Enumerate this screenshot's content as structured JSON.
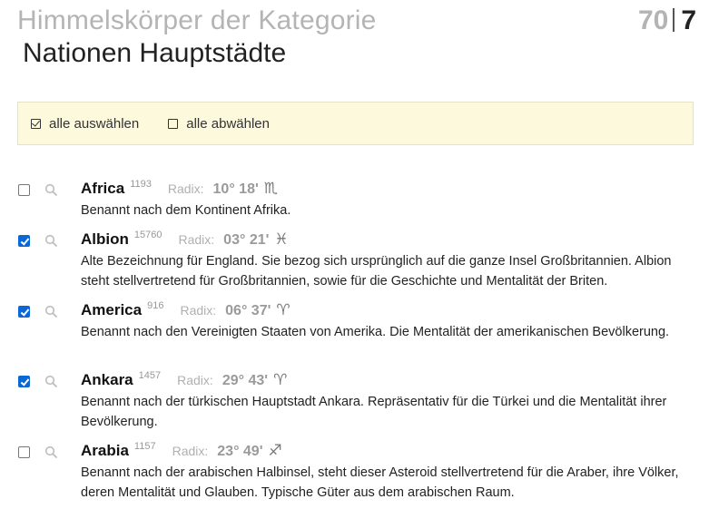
{
  "header": {
    "category_line": "Himmelskörper der Kategorie",
    "title": "Nationen Hauptstädte",
    "count_total": "70",
    "count_selected": "7"
  },
  "selection_bar": {
    "select_all": "alle auswählen",
    "deselect_all": "alle abwählen"
  },
  "radix_label": "Radix:",
  "items": [
    {
      "name": "Africa",
      "number": "1193",
      "position": "10° 18'",
      "sign": "♏",
      "checked": false,
      "description": "Benannt nach dem Kontinent Afrika."
    },
    {
      "name": "Albion",
      "number": "15760",
      "position": "03° 21'",
      "sign": "♓",
      "checked": true,
      "description": "Alte Bezeichnung für England. Sie bezog sich ursprünglich auf die ganze Insel Großbritannien. Albion steht stellvertretend für Großbritannien, sowie für die Geschichte und Mentalität der Briten."
    },
    {
      "name": "America",
      "number": "916",
      "position": "06° 37'",
      "sign": "♈",
      "checked": true,
      "description": "Benannt nach den Vereinigten Staaten von Amerika. Die Mentalität der amerikanischen Bevölkerung."
    },
    {
      "name": "Ankara",
      "number": "1457",
      "position": "29° 43'",
      "sign": "♈",
      "checked": true,
      "description": "Benannt nach der türkischen Hauptstadt Ankara. Repräsentativ für die Türkei und die Mentalität ihrer Bevölkerung."
    },
    {
      "name": "Arabia",
      "number": "1157",
      "position": "23° 49'",
      "sign": "♐",
      "checked": false,
      "description": "Benannt nach der arabischen Halbinsel, steht dieser Asteroid stellvertretend für die Araber, ihre Völker, deren Mentalität und Glauben. Typische Güter aus dem arabischen Raum."
    }
  ],
  "colors": {
    "highlight_bar": "#fdf9dc",
    "checkbox_checked": "#0b66d6",
    "muted_text": "#b4b4b4"
  },
  "icons": {
    "select_all": "checked-box-icon",
    "deselect_all": "empty-box-icon",
    "detail": "magnifier-icon"
  }
}
